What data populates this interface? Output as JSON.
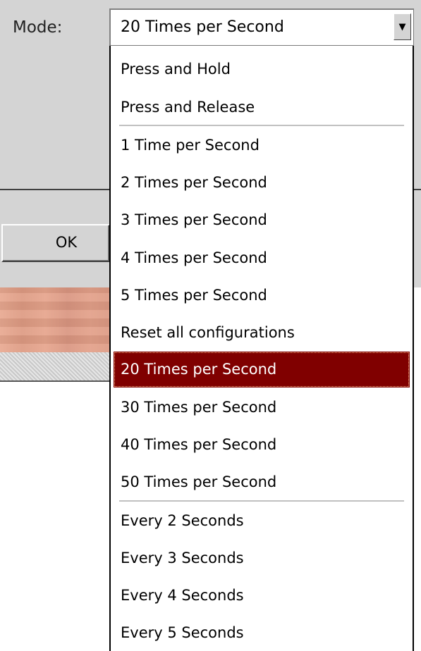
{
  "mode_label": "Mode:",
  "combo": {
    "value": "20 Times per Second",
    "arrow_icon": "chevron-down-icon"
  },
  "ok_button_label": "OK",
  "dropdown": {
    "items": [
      "Press and Hold",
      "Press and Release",
      "1 Time per Second",
      "2 Times per Second",
      "3 Times per Second",
      "4 Times per Second",
      "5 Times per Second",
      "Reset all configurations",
      "20 Times per Second",
      "30 Times per Second",
      "40 Times per Second",
      "50 Times per Second",
      "Every 2 Seconds",
      "Every 3 Seconds",
      "Every 4 Seconds",
      "Every 5 Seconds"
    ],
    "selected_index": 8,
    "selected_color": "#800000"
  }
}
